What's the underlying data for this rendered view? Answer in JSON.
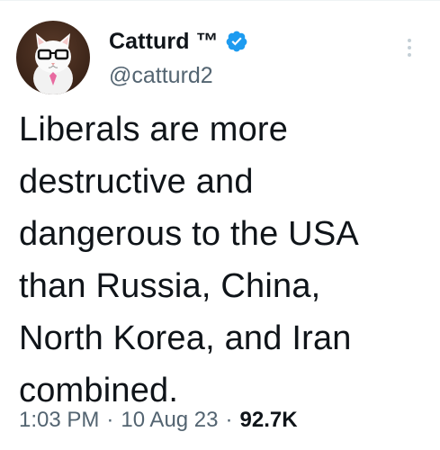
{
  "user": {
    "display_name": "Catturd ™",
    "handle": "@catturd2",
    "verified_color": "#1d9bf0"
  },
  "tweet": {
    "text": "Liberals are more\ndestructive and\ndangerous to the USA\nthan Russia, China,\nNorth Korea, and Iran\ncombined.",
    "time": "1:03 PM",
    "date": "10 Aug 23",
    "views": "92.7K"
  },
  "icons": {
    "avatar": "cat-avatar-icon",
    "verified": "verified-badge-icon",
    "more": "more-options-icon"
  },
  "colors": {
    "text_primary": "#0f1419",
    "text_secondary": "#536471",
    "accent": "#1d9bf0"
  }
}
